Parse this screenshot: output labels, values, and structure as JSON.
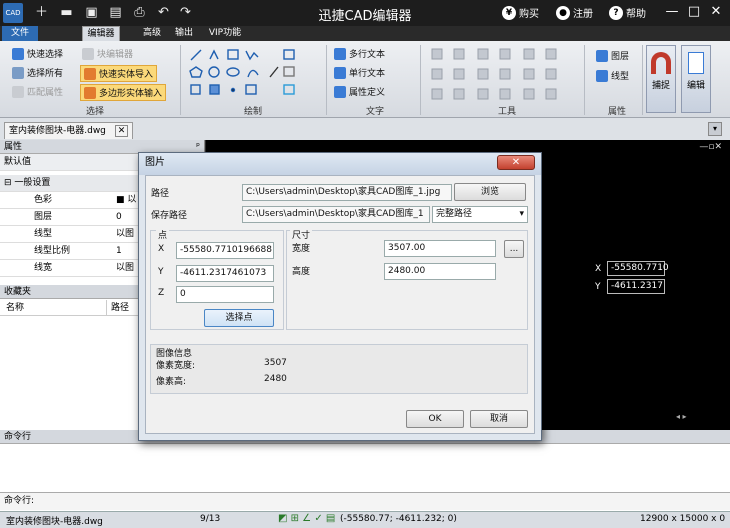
{
  "app": {
    "title": "迅捷CAD编辑器"
  },
  "titlebar": {
    "buy": "购买",
    "register": "注册",
    "help": "帮助"
  },
  "menus": [
    "文件",
    "编辑器",
    "高级",
    "输出",
    "VIP功能"
  ],
  "ribbon": {
    "select": {
      "quick_select": "快速选择",
      "select_all": "选择所有",
      "match_props": "匹配属性",
      "block_editor": "块编辑器",
      "quick_import": "快速实体导入",
      "polygon_input": "多边形实体输入",
      "label": "选择"
    },
    "draw_label": "绘制",
    "text": {
      "mtext": "多行文本",
      "stext": "单行文本",
      "attdef": "属性定义",
      "label": "文字"
    },
    "tools_label": "工具",
    "props": {
      "layer": "图层",
      "linetype": "线型",
      "label": "属性"
    },
    "snap": "捕捉",
    "edit": "编辑"
  },
  "doc_tab": "室内装修图块-电器.dwg",
  "props_panel": {
    "header": "属性",
    "default": "默认值",
    "section": "一般设置",
    "rows": [
      {
        "name": "色彩",
        "value": "■ 以"
      },
      {
        "name": "图层",
        "value": "0"
      },
      {
        "name": "线型",
        "value": "以图"
      },
      {
        "name": "线型比例",
        "value": "1"
      },
      {
        "name": "线宽",
        "value": "以图"
      }
    ]
  },
  "favorites": {
    "header": "收藏夹",
    "col_name": "名称",
    "col_path": "路径"
  },
  "canvas": {
    "x_label": "X",
    "x_value": "-55580.7710",
    "y_label": "Y",
    "y_value": "-4611.2317"
  },
  "dialog": {
    "title": "图片",
    "path_label": "路径",
    "path_value": "C:\\Users\\admin\\Desktop\\家具CAD图库_1.jpg",
    "browse": "浏览",
    "save_path_label": "保存路径",
    "save_path_value": "C:\\Users\\admin\\Desktop\\家具CAD图库_1",
    "save_path_mode": "完整路径",
    "point_label": "点",
    "x_label": "X",
    "x_value": "-55580.7710196688",
    "y_label": "Y",
    "y_value": "-4611.2317461073",
    "z_label": "Z",
    "z_value": "0",
    "pick_point": "选择点",
    "size_label": "尺寸",
    "width_label": "宽度",
    "width_value": "3507.00",
    "height_label": "高度",
    "height_value": "2480.00",
    "more": "...",
    "info_label": "图像信息",
    "pixel_width_label": "像素宽度:",
    "pixel_width": "3507",
    "pixel_height_label": "像素高:",
    "pixel_height": "2480",
    "ok": "OK",
    "cancel": "取消"
  },
  "command": {
    "header": "命令行",
    "prompt": "命令行:"
  },
  "status": {
    "file": "室内装修图块-电器.dwg",
    "page": "9/13",
    "coords": "(-55580.77; -4611.232; 0)",
    "size": "12900 x 15000 x 0"
  }
}
